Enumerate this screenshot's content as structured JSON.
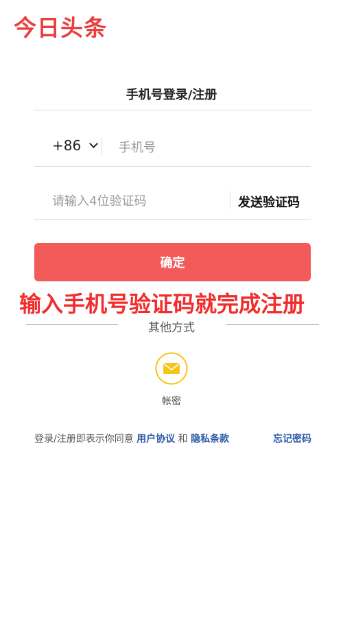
{
  "app": {
    "logo_text": "今日头条",
    "brand_color": "#e8403f"
  },
  "login": {
    "title": "手机号登录/注册",
    "country_code": "+86",
    "phone_placeholder": "手机号",
    "code_placeholder": "请输入4位验证码",
    "send_code_label": "发送验证码",
    "confirm_label": "确定",
    "confirm_color": "#f35a5a"
  },
  "overlay": {
    "caption": "输入手机号验证码就完成注册",
    "color": "#f22b2b"
  },
  "other_methods": {
    "title": "其他方式",
    "account_label": "帐密",
    "account_icon": "envelope-icon",
    "icon_color": "#f5c518"
  },
  "footer": {
    "agreement_prefix": "登录/注册即表示你同意",
    "user_agreement": "用户协议",
    "and": "和",
    "privacy_policy": "隐私条款",
    "forgot_password": "忘记密码",
    "link_color": "#2b5aa6"
  }
}
